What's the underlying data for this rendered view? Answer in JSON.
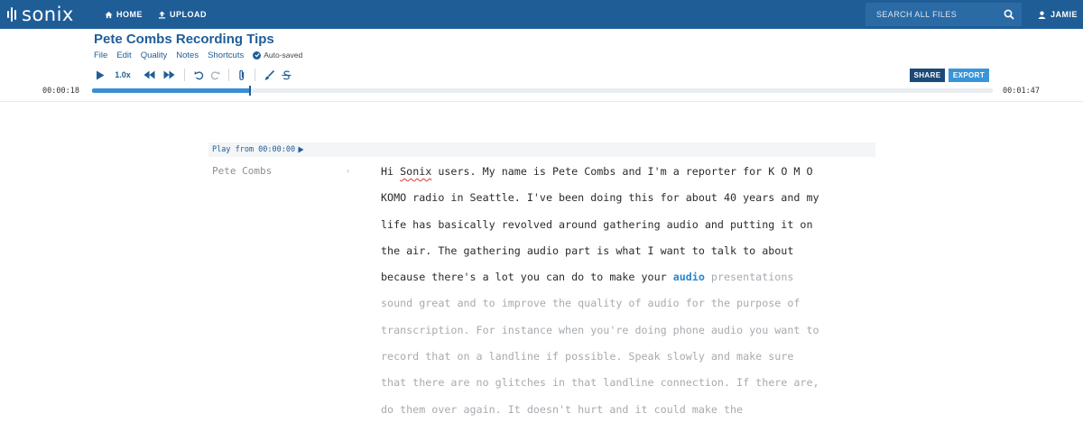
{
  "nav": {
    "brand": "sonix",
    "home_label": "HOME",
    "upload_label": "UPLOAD",
    "search_placeholder": "SEARCH ALL FILES",
    "user_label": "JAMIE",
    "bar_color": "#1f5d97"
  },
  "document": {
    "title": "Pete Combs Recording Tips",
    "menu": [
      "File",
      "Edit",
      "Quality",
      "Notes",
      "Shortcuts"
    ],
    "autosave_status": "Auto-saved"
  },
  "player": {
    "speed": "1.0x",
    "current_time": "00:00:18",
    "total_time": "00:01:47",
    "progress_percent": 17.5,
    "share_label": "SHARE",
    "export_label": "EXPORT"
  },
  "transcript": {
    "play_from": "Play from 00:00:00",
    "speaker": "Pete Combs",
    "lines": [
      [
        {
          "t": "Hi "
        },
        {
          "t": "Sonix",
          "cls": "squiggle"
        },
        {
          "t": " users. My name is Pete Combs and I'm a reporter for K O M O"
        }
      ],
      [
        {
          "t": "KOMO radio in Seattle. I've been doing this for about 40 years and my"
        }
      ],
      [
        {
          "t": "life has basically revolved around gathering audio and putting it on"
        }
      ],
      [
        {
          "t": "the air. The gathering audio part is what I want to talk to about"
        }
      ],
      [
        {
          "t": "because there's a lot you can do to make your "
        },
        {
          "t": "audio",
          "cls": "current"
        },
        {
          "t": " presentations",
          "cls": "future"
        }
      ],
      [
        {
          "t": "sound great and to improve the quality of audio for the purpose of",
          "cls": "future"
        }
      ],
      [
        {
          "t": "transcription. For instance when you're doing phone audio you want to",
          "cls": "future"
        }
      ],
      [
        {
          "t": "record that on a landline if possible. Speak slowly and make sure",
          "cls": "future"
        }
      ],
      [
        {
          "t": "that there are no glitches in that landline connection. If there are,",
          "cls": "future"
        }
      ],
      [
        {
          "t": "do them over again. It doesn't hurt and it could make the",
          "cls": "future"
        }
      ]
    ]
  }
}
